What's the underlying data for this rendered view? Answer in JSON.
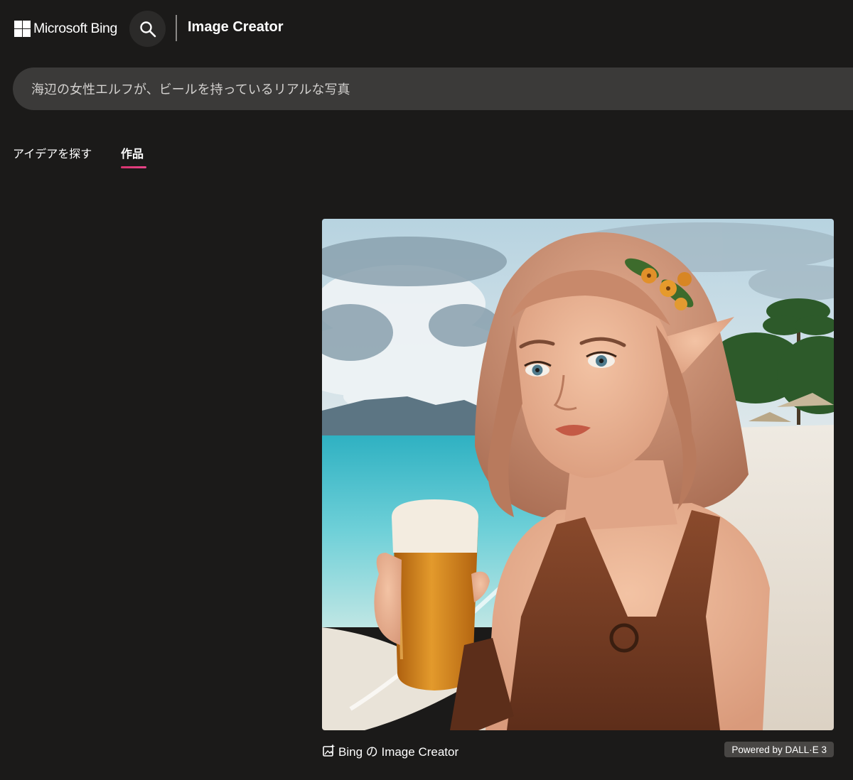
{
  "header": {
    "brand": "Microsoft Bing",
    "app_title": "Image Creator",
    "icons": {
      "logo": "microsoft-logo-icon",
      "search": "search-icon"
    }
  },
  "prompt": {
    "value": "海辺の女性エルフが、ビールを持っているリアルな写真"
  },
  "tabs": [
    {
      "label": "アイデアを探す",
      "active": false
    },
    {
      "label": "作品",
      "active": true
    }
  ],
  "image": {
    "alt": "海辺の女性エルフが、ビールを持っているリアルな写真"
  },
  "footer": {
    "attribution": "Bing の Image Creator",
    "powered_by": "Powered by DALL·E 3",
    "icon": "image-creator-icon"
  },
  "colors": {
    "background": "#1b1a19",
    "prompt_bar": "#3b3a39",
    "active_tab_accent": "#d6336c",
    "badge": "#484644"
  }
}
